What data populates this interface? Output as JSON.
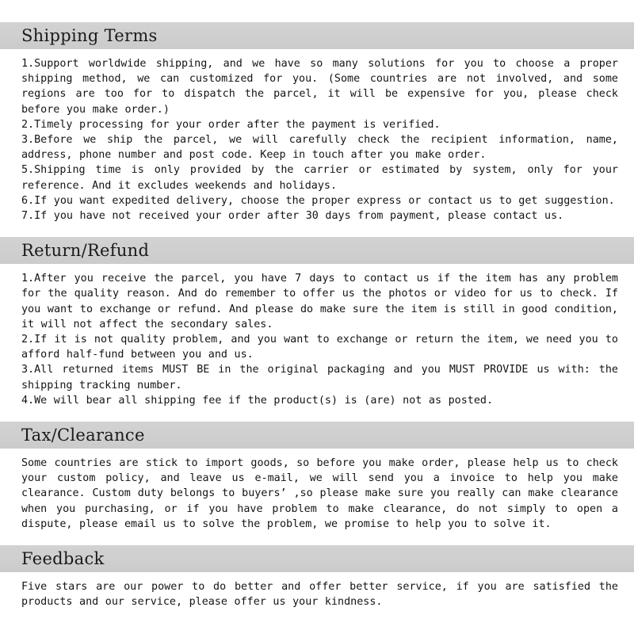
{
  "document": {
    "background_color": "#ffffff",
    "header_band_color": "#cfcfcf",
    "text_color": "#141414"
  },
  "sections": [
    {
      "key": "shipping",
      "title": "Shipping Terms",
      "paragraphs": [
        "1.Support worldwide shipping, and we have so many solutions for you to choose a proper shipping method, we can customized for you. (Some countries are not involved, and some regions are too for to dispatch the parcel, it will be expensive for you, please check before you make order.)",
        "2.Timely processing for your order after the payment is verified.",
        "3.Before we ship the parcel, we will carefully check the recipient information, name, address, phone number and post code. Keep in touch after you make order.",
        "5.Shipping time is only provided by the carrier or estimated by system, only for your reference. And it excludes weekends and holidays.",
        "6.If you want expedited delivery, choose the proper express or contact us to get suggestion.",
        "7.If you have not received your order after 30 days from payment, please contact us."
      ]
    },
    {
      "key": "return",
      "title": "Return/Refund",
      "paragraphs": [
        "1.After you receive the parcel, you have 7 days to contact us if the item has any problem for the quality reason. And do remember to offer us the photos or video for us to check. If you want to exchange or refund. And please do make sure the item is still in good condition, it will not affect the secondary sales.",
        "2.If it is not quality problem, and you want to exchange or return the item, we need you to afford half-fund between you and us.",
        "3.All returned items MUST BE in the original packaging and you MUST PROVIDE us with: the shipping tracking number.",
        "4.We will bear all shipping fee if the product(s) is (are) not as posted."
      ]
    },
    {
      "key": "tax",
      "title": "Tax/Clearance",
      "paragraphs": [
        "Some countries are stick to import goods, so before you make order, please help us to check your custom policy, and leave us e-mail, we will send you a invoice to help you make clearance. Custom duty belongs to buyers’ ,so please make sure you really can make clearance when you purchasing, or if you have problem to make clearance, do not simply to open a dispute, please email us to solve the problem, we promise to help you to solve it."
      ]
    },
    {
      "key": "feedback",
      "title": "Feedback",
      "paragraphs": [
        "Five stars are our power to do better and offer better service, if you are satisfied the products and our service, please offer us your kindness."
      ]
    }
  ]
}
